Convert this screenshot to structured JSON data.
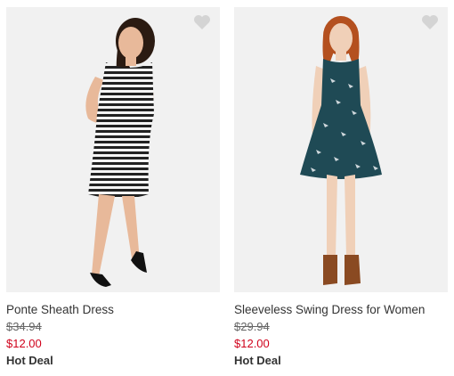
{
  "products": [
    {
      "name": "Ponte Sheath Dress",
      "original_price": "$34.94",
      "sale_price": "$12.00",
      "badge": "Hot Deal",
      "image_icon": "product-photo-striped-dress",
      "favorite_icon": "heart-icon"
    },
    {
      "name": "Sleeveless Swing Dress for Women",
      "original_price": "$29.94",
      "sale_price": "$12.00",
      "badge": "Hot Deal",
      "image_icon": "product-photo-teal-print-dress",
      "favorite_icon": "heart-icon"
    }
  ],
  "colors": {
    "sale_price": "#d0021b",
    "text": "#333333",
    "image_bg": "#f1f1f1",
    "heart": "#d4d4d4"
  }
}
